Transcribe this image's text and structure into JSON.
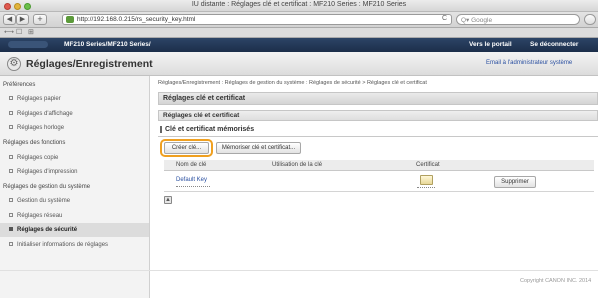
{
  "window": {
    "title": "IU distante : Réglages clé et certificat : MF210 Series : MF210 Series"
  },
  "toolbar": {
    "back": "◀",
    "forward": "▶",
    "add": "+",
    "url": "http://192.168.0.215/rs_security_key.html",
    "reload": "C",
    "search_placeholder": "Q▾ Google"
  },
  "bookmarks": {
    "reader": "⟷",
    "book": "☐",
    "grid": "⊞"
  },
  "header": {
    "device": "MF210 Series/MF210 Series/",
    "portal_link": "Vers le portail",
    "logout_link": "Se déconnecter",
    "page_title": "Réglages/Enregistrement",
    "email_admin": "Email à l'administrateur système"
  },
  "sidebar": {
    "sections": [
      {
        "title": "Préférences",
        "items": [
          "Réglages papier",
          "Réglages d'affichage",
          "Réglages horloge"
        ]
      },
      {
        "title": "Réglages des fonctions",
        "items": [
          "Réglages copie",
          "Réglages d'impression"
        ]
      },
      {
        "title": "Réglages de gestion du système",
        "items": [
          "Gestion du système",
          "Réglages réseau",
          "Réglages de sécurité",
          "Initialiser informations de réglages"
        ]
      }
    ],
    "selected": "Réglages de sécurité"
  },
  "main": {
    "breadcrumb": "Réglages/Enregistrement : Réglages de gestion du système : Réglages de sécurité > Réglages clé et certificat",
    "page_heading": "Réglages clé et certificat",
    "section_heading": "Réglages clé et certificat",
    "subsection_heading": "Clé et certificat mémorisés",
    "create_key_button": "Créer clé...",
    "register_button": "Mémoriser clé et certificat...",
    "table": {
      "headers": [
        "Nom de clé",
        "Utilisation de la clé",
        "Certificat"
      ],
      "rows": [
        {
          "key_name": "Default Key",
          "usage": "",
          "delete_label": "Supprimer"
        }
      ]
    }
  },
  "footer": {
    "copyright": "Copyright CANON INC. 2014"
  },
  "colors": {
    "header_navy": "#1c2e4a",
    "highlight": "#f0a020",
    "link": "#2a4fa0"
  }
}
